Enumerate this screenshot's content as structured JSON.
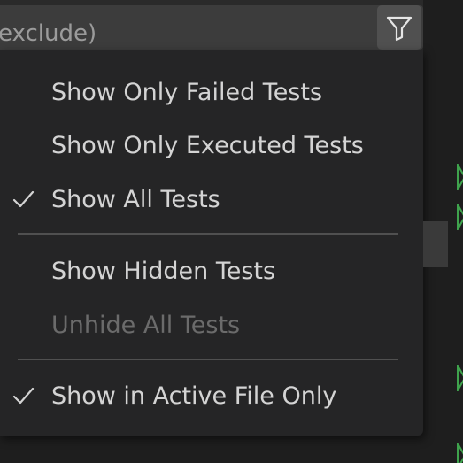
{
  "filter": {
    "text": "exclude)",
    "filter_icon": "filter-icon"
  },
  "menu": {
    "items": [
      {
        "label": "Show Only Failed Tests",
        "checked": false,
        "enabled": true
      },
      {
        "label": "Show Only Executed Tests",
        "checked": false,
        "enabled": true
      },
      {
        "label": "Show All Tests",
        "checked": true,
        "enabled": true
      },
      {
        "label": "Show Hidden Tests",
        "checked": false,
        "enabled": true
      },
      {
        "label": "Unhide All Tests",
        "checked": false,
        "enabled": false
      },
      {
        "label": "Show in Active File Only",
        "checked": true,
        "enabled": true
      }
    ],
    "check_icon": "check-icon"
  },
  "colors": {
    "menu_background": "#252526",
    "text": "#d4d4d4",
    "disabled_text": "#6b6b6b",
    "run_arrow": "#3fa34d"
  }
}
